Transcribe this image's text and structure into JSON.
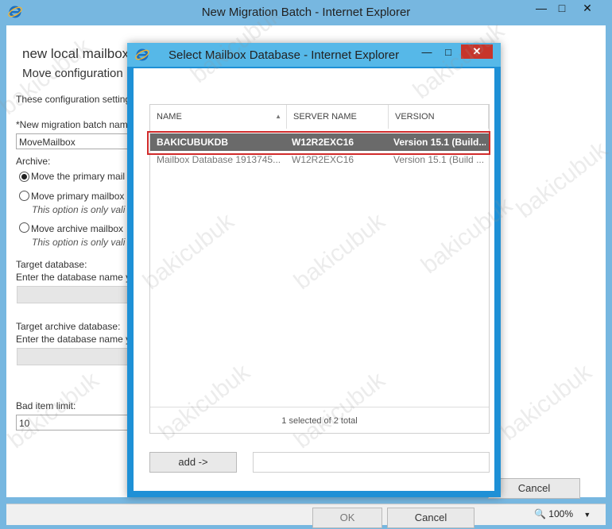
{
  "outer": {
    "title": "New Migration Batch - Internet Explorer",
    "header": "new local mailbox",
    "subheader": "Move configuration",
    "desc": "These configuration setting",
    "batch_name_label": "*New migration batch nam",
    "batch_name_value": "MoveMailbox",
    "archive_label": "Archive:",
    "radio1": "Move the primary mail",
    "radio2": "Move primary mailbox",
    "radio2_note": "This option is only vali",
    "radio3": "Move archive mailbox",
    "radio3_note": "This option is only vali",
    "target_db_label": "Target database:",
    "target_db_hint": "Enter the database name y",
    "target_arch_label": "Target archive database:",
    "target_arch_hint": "Enter the database name y",
    "bad_item_label": "Bad item limit:",
    "bad_item_value": "10",
    "cancel": "Cancel",
    "zoom": "100%"
  },
  "dialog": {
    "title": "Select Mailbox Database - Internet Explorer",
    "columns": [
      "NAME",
      "SERVER NAME",
      "VERSION"
    ],
    "rows": [
      {
        "name": "BAKICUBUKDB",
        "server": "W12R2EXC16",
        "version": "Version 15.1 (Build..."
      },
      {
        "name": "Mailbox Database 1913745...",
        "server": "W12R2EXC16",
        "version": "Version 15.1 (Build ..."
      }
    ],
    "footer": "1 selected of 2 total",
    "add": "add ->",
    "ok": "OK",
    "cancel": "Cancel"
  },
  "watermark": "bakicubuk"
}
